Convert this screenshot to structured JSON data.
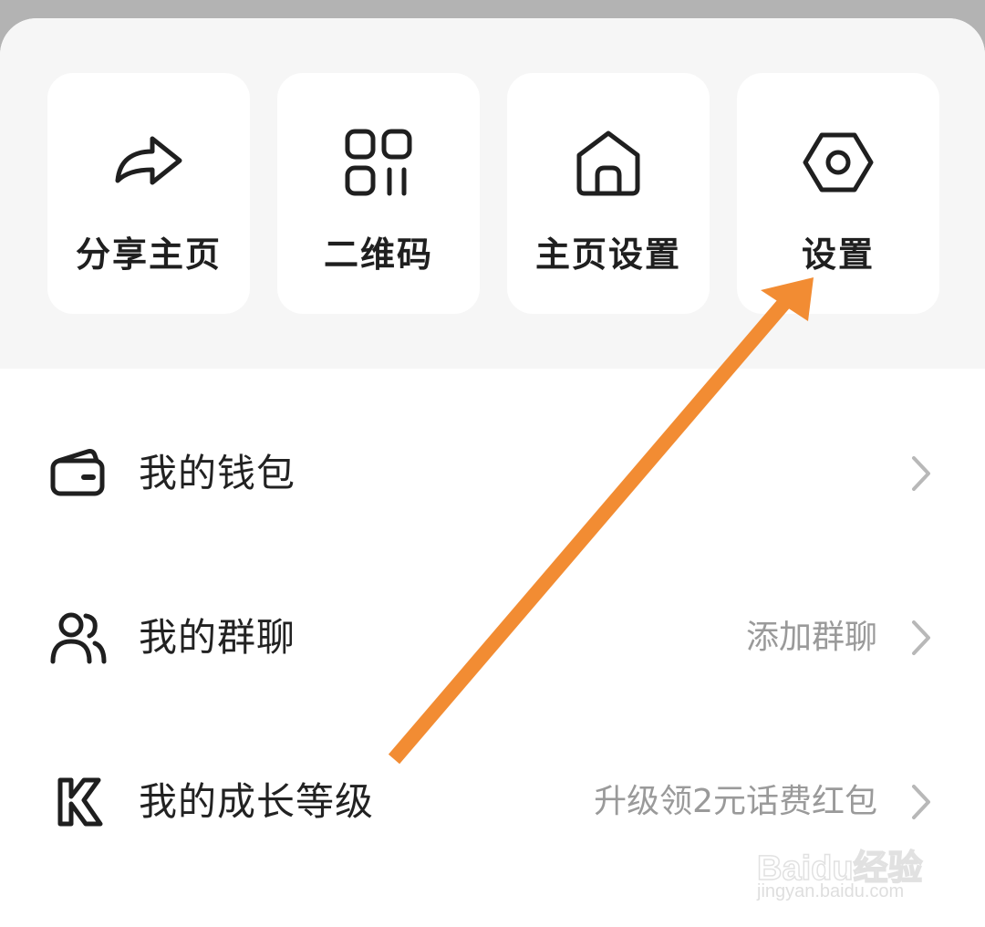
{
  "quick_actions": [
    {
      "label": "分享主页",
      "icon": "share-icon"
    },
    {
      "label": "二维码",
      "icon": "qr-code-icon"
    },
    {
      "label": "主页设置",
      "icon": "home-icon"
    },
    {
      "label": "设置",
      "icon": "settings-icon"
    }
  ],
  "menu": [
    {
      "label": "我的钱包",
      "value": "",
      "icon": "wallet-icon"
    },
    {
      "label": "我的群聊",
      "value": "添加群聊",
      "icon": "group-chat-icon"
    },
    {
      "label": "我的成长等级",
      "value": "升级领2元话费红包",
      "icon": "growth-level-icon"
    }
  ],
  "annotation": {
    "color": "#f28c33",
    "target": "设置"
  },
  "watermark": {
    "brand": "Baidu经验",
    "url": "jingyan.baidu.com"
  },
  "colors": {
    "background": "#b3b3b3",
    "panel": "#f6f6f6",
    "text": "#222222",
    "secondary_text": "#9a9a9a"
  }
}
